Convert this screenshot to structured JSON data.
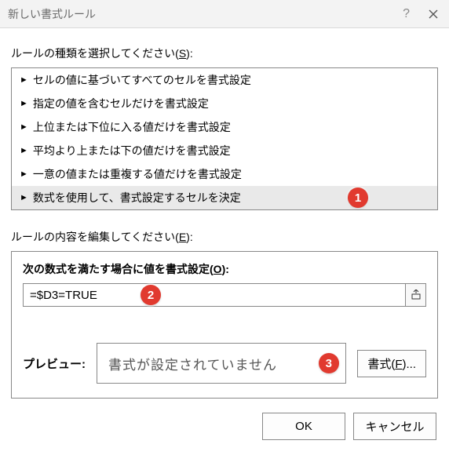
{
  "titlebar": {
    "title": "新しい書式ルール",
    "help_symbol": "?",
    "close_label": "close"
  },
  "rule_type_section": {
    "label_pre": "ルールの種類を選択してください(",
    "label_accel": "S",
    "label_post": "):",
    "items": [
      "セルの値に基づいてすべてのセルを書式設定",
      "指定の値を含むセルだけを書式設定",
      "上位または下位に入る値だけを書式設定",
      "平均より上または下の値だけを書式設定",
      "一意の値または重複する値だけを書式設定",
      "数式を使用して、書式設定するセルを決定"
    ],
    "selected_index": 5
  },
  "rule_content_section": {
    "label_pre": "ルールの内容を編集してください(",
    "label_accel": "E",
    "label_post": "):"
  },
  "formula": {
    "label_pre": "次の数式を満たす場合に値を書式設定(",
    "label_accel": "O",
    "label_post": "):",
    "value": "=$D3=TRUE"
  },
  "preview": {
    "label": "プレビュー:",
    "text": "書式が設定されていません",
    "format_btn_pre": "書式(",
    "format_btn_accel": "F",
    "format_btn_post": ")..."
  },
  "buttons": {
    "ok": "OK",
    "cancel": "キャンセル"
  },
  "annotations": {
    "b1": "1",
    "b2": "2",
    "b3": "3"
  }
}
